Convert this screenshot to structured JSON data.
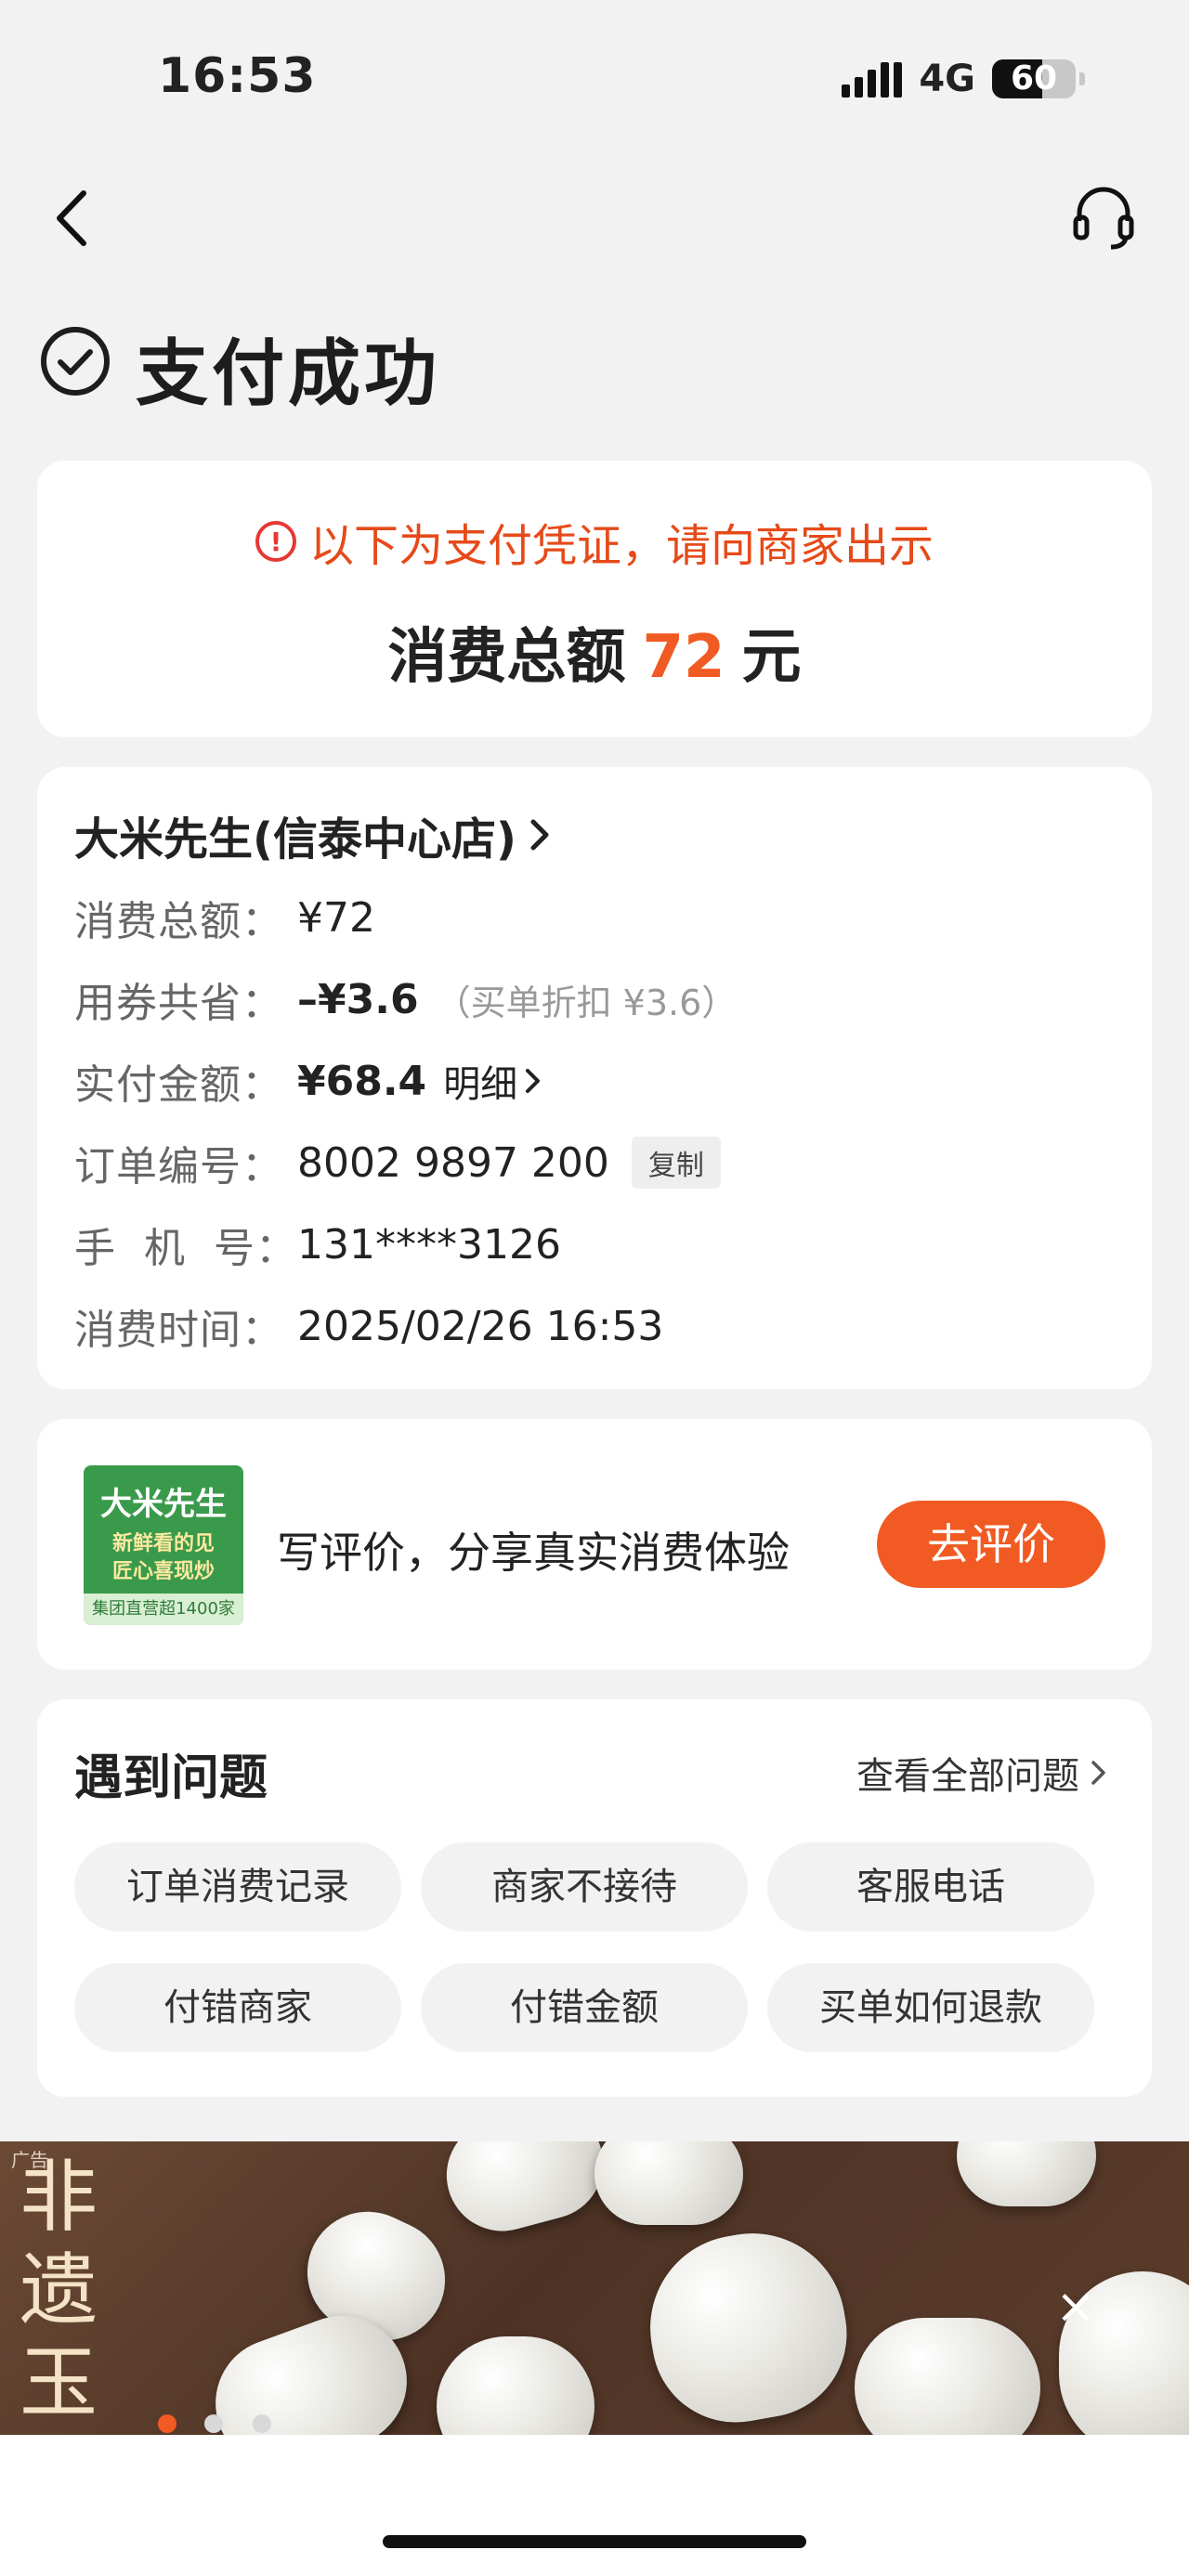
{
  "status_bar": {
    "time": "16:53",
    "network": "4G",
    "battery": "60"
  },
  "page_title": "支付成功",
  "voucher": {
    "notice": "以下为支付凭证，请向商家出示",
    "total_label": "消费总额",
    "total_amount": "72",
    "total_unit": "元"
  },
  "order": {
    "shop_name": "大米先生(信泰中心店)",
    "rows": {
      "total": {
        "label": "消费总额：",
        "value": "¥72"
      },
      "coupon": {
        "label": "用券共省：",
        "value": "–¥3.6",
        "note": "（买单折扣 ¥3.6）"
      },
      "paid": {
        "label": "实付金额：",
        "value": "¥68.4",
        "detail": "明细"
      },
      "order_no": {
        "label": "订单编号：",
        "value": "8002 9897 200",
        "copy": "复制"
      },
      "phone": {
        "label": "手  机  号：",
        "value": "131****3126"
      },
      "time": {
        "label": "消费时间：",
        "value": "2025/02/26 16:53"
      }
    }
  },
  "review": {
    "logo_title": "大米先生",
    "logo_line1": "新鲜看的见",
    "logo_line2": "匠心喜现炒",
    "logo_footer": "集团直营超1400家",
    "text": "写评价，分享真实消费体验",
    "button": "去评价"
  },
  "problems": {
    "title": "遇到问题",
    "view_all": "查看全部问题",
    "chips": [
      "订单消费记录",
      "商家不接待",
      "客服电话",
      "付错商家",
      "付错金额",
      "买单如何退款"
    ]
  },
  "banner": {
    "ad_tag": "广告",
    "vertical_text": "非遗玉雕",
    "active_dot": 0
  },
  "colors": {
    "accent": "#f15a22",
    "warning": "#e53935",
    "background": "#f2f2f2"
  }
}
